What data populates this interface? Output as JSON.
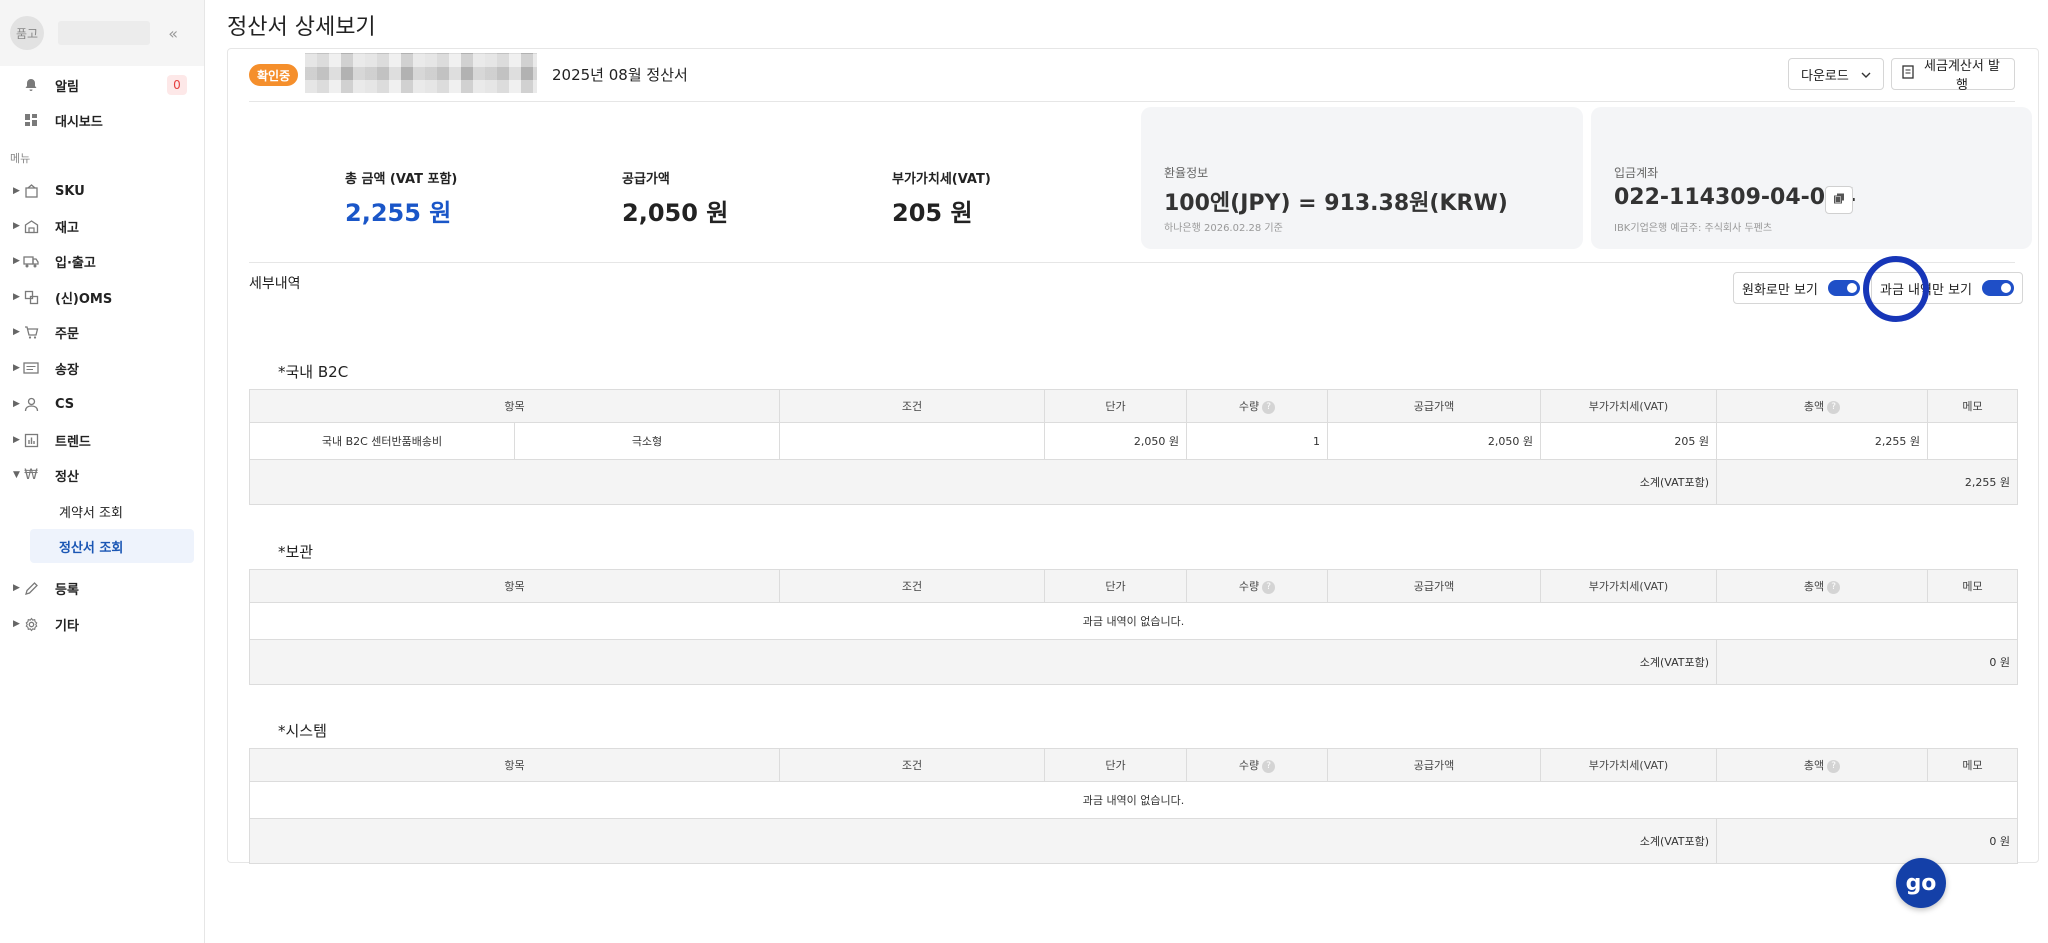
{
  "sidebar": {
    "avatar_text": "품고",
    "notifications": {
      "label": "알림",
      "count": "0"
    },
    "dashboard": "대시보드",
    "menu_heading": "메뉴",
    "items": [
      {
        "label": "SKU",
        "icon": "box-icon"
      },
      {
        "label": "재고",
        "icon": "warehouse-icon"
      },
      {
        "label": "입·출고",
        "icon": "truck-icon"
      },
      {
        "label": "(신)OMS",
        "icon": "oms-icon"
      },
      {
        "label": "주문",
        "icon": "cart-icon"
      },
      {
        "label": "송장",
        "icon": "invoice-icon"
      },
      {
        "label": "CS",
        "icon": "person-icon"
      },
      {
        "label": "트렌드",
        "icon": "chart-icon"
      },
      {
        "label": "정산",
        "icon": "won-icon"
      },
      {
        "label": "등록",
        "icon": "pencil-icon"
      },
      {
        "label": "기타",
        "icon": "gear-icon"
      }
    ],
    "settlement_sub": [
      "계약서 조회",
      "정산서 조회"
    ]
  },
  "page": {
    "title": "정산서 상세보기",
    "status": "확인중",
    "period": "2025년 08월 정산서",
    "download_label": "다운로드",
    "tax_invoice_label": "세금계산서 발행"
  },
  "summary": {
    "total_label": "총 금액 (VAT 포함)",
    "total_value": "2,255 원",
    "supply_label": "공급가액",
    "supply_value": "2,050 원",
    "vat_label": "부가가치세(VAT)",
    "vat_value": "205 원"
  },
  "exchange": {
    "label": "환율정보",
    "value": "100엔(JPY) = 913.38원(KRW)",
    "note": "하나은행 2026.02.28 기준"
  },
  "account": {
    "label": "입금계좌",
    "value": "022-114309-04-014",
    "note": "IBK기업은행 예금주: 주식회사 두펜츠"
  },
  "details": {
    "label": "세부내역",
    "toggle_krw": "원화로만 보기",
    "toggle_billed": "과금 내역만 보기"
  },
  "columns": [
    "항목",
    "조건",
    "단가",
    "수량",
    "공급가액",
    "부가가치세(VAT)",
    "총액",
    "메모"
  ],
  "groups": [
    {
      "title": "*국내 B2C",
      "rows": [
        {
          "item": "국내 B2C 센터반품배송비",
          "sub": "극소형",
          "cond": "",
          "unit": "2,050 원",
          "qty": "1",
          "supply": "2,050 원",
          "vat": "205 원",
          "total": "2,255 원",
          "memo": ""
        }
      ],
      "subtotal_label": "소계(VAT포함)",
      "subtotal": "2,255 원"
    },
    {
      "title": "*보관",
      "empty": "과금 내역이 없습니다.",
      "subtotal_label": "소계(VAT포함)",
      "subtotal": "0 원"
    },
    {
      "title": "*시스템",
      "empty": "과금 내역이 없습니다.",
      "subtotal_label": "소계(VAT포함)",
      "subtotal": "0 원"
    }
  ],
  "fab_label": "go"
}
